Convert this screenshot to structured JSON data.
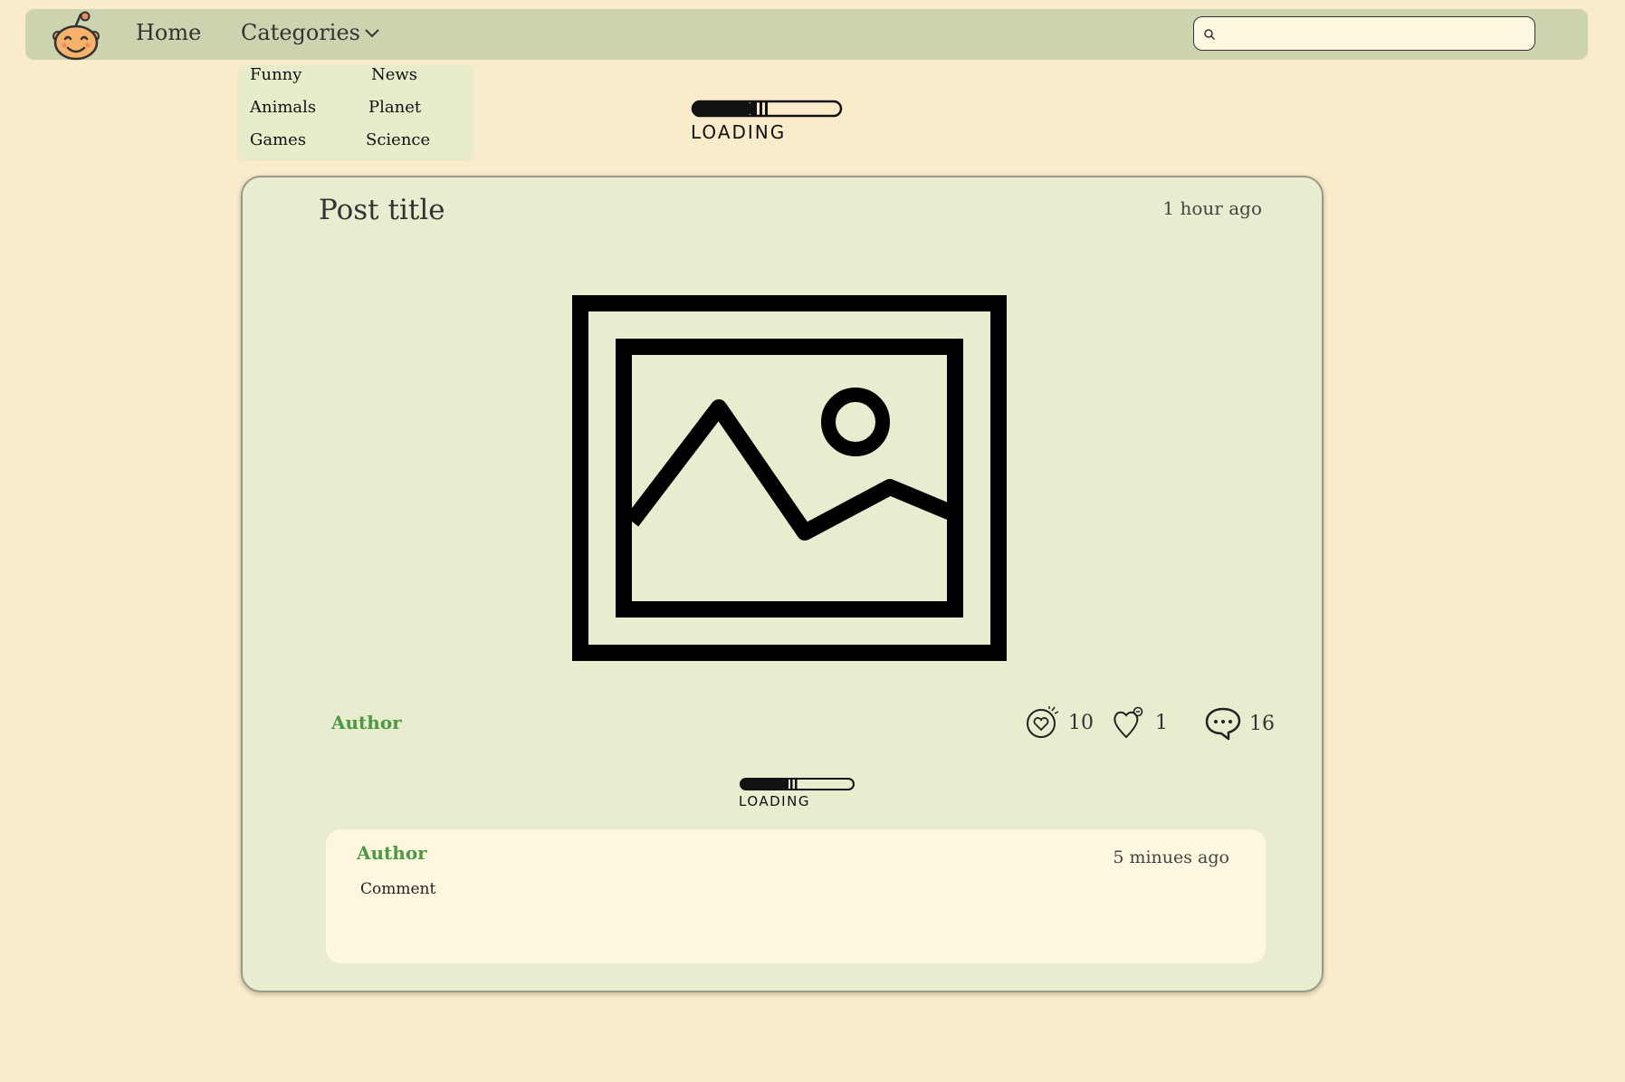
{
  "nav": {
    "home_label": "Home",
    "categories_label": "Categories",
    "search": {
      "value": "",
      "placeholder": ""
    }
  },
  "dropdown": {
    "items": [
      "Funny",
      "News",
      "Animals",
      "Planet",
      "Games",
      "Science"
    ]
  },
  "loading": {
    "top_label": "LOADING",
    "comments_label": "LOADING"
  },
  "post": {
    "title": "Post title",
    "time": "1 hour ago",
    "author": "Author",
    "stats": {
      "likes": "10",
      "dislikes": "1",
      "comments": "16"
    }
  },
  "comment": {
    "author": "Author",
    "time": "5 minues ago",
    "text": "Comment"
  },
  "colors": {
    "background": "#faebcb",
    "navbar": "#cbd4ae",
    "card": "#e9ecce",
    "comment_bg": "#fdf7df",
    "author": "#4a9a44"
  }
}
